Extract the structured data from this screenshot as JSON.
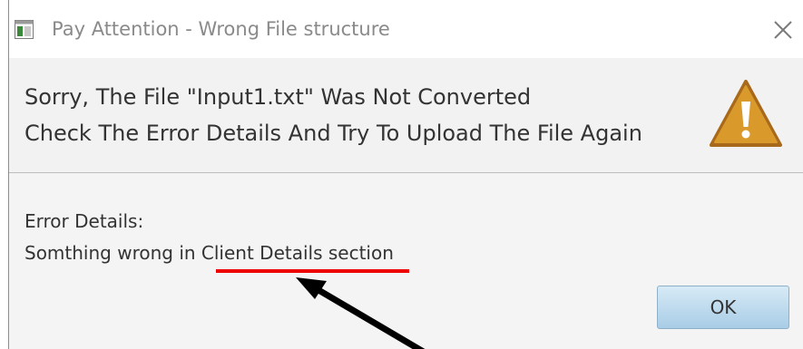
{
  "window": {
    "title": "Pay Attention - Wrong File structure"
  },
  "header": {
    "line1": "Sorry, The File \"Input1.txt\" Was Not Converted",
    "line2": "Check The Error Details And Try To Upload The File Again"
  },
  "content": {
    "details_label": "Error Details:",
    "details_message": "Somthing wrong in Client Details section"
  },
  "buttons": {
    "ok_label": "OK"
  },
  "icons": {
    "app": "app-window-icon",
    "close": "close-icon",
    "warning": "warning-triangle-icon"
  },
  "colors": {
    "warning_fill": "#d99a2b",
    "ok_button": "#bcdcf0",
    "annotation_underline": "#ee0000",
    "annotation_arrow": "#000000"
  }
}
